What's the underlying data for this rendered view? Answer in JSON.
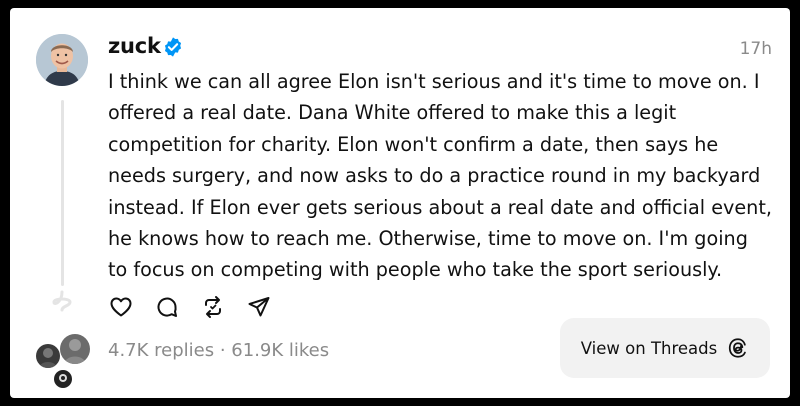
{
  "post": {
    "username": "zuck",
    "time": "17h",
    "lines": [
      "I think we can all agree Elon isn't serious and it's time to move on. I",
      "offered a real date. Dana White offered to make this a legit",
      "competition for charity. Elon won't confirm a date, then says he",
      "needs surgery, and now asks to do a practice round in my backyard",
      "instead. If Elon ever gets serious about a real date and official event,",
      "he knows how to reach me. Otherwise, time to move on. I'm going",
      "to focus on competing with people who take the sport seriously."
    ]
  },
  "stats": {
    "replies": "4.7K replies",
    "separator": " · ",
    "likes": "61.9K likes"
  },
  "view_button": {
    "label": "View on Threads"
  },
  "icons": {
    "verified": "verified-badge-icon",
    "like": "heart-icon",
    "reply": "comment-icon",
    "repost": "repost-icon",
    "share": "send-icon",
    "threads": "threads-logo-icon"
  },
  "colors": {
    "verified": "#0095f6",
    "muted": "#8a8a8a",
    "text": "#111111",
    "button_bg": "#f2f2f2"
  }
}
